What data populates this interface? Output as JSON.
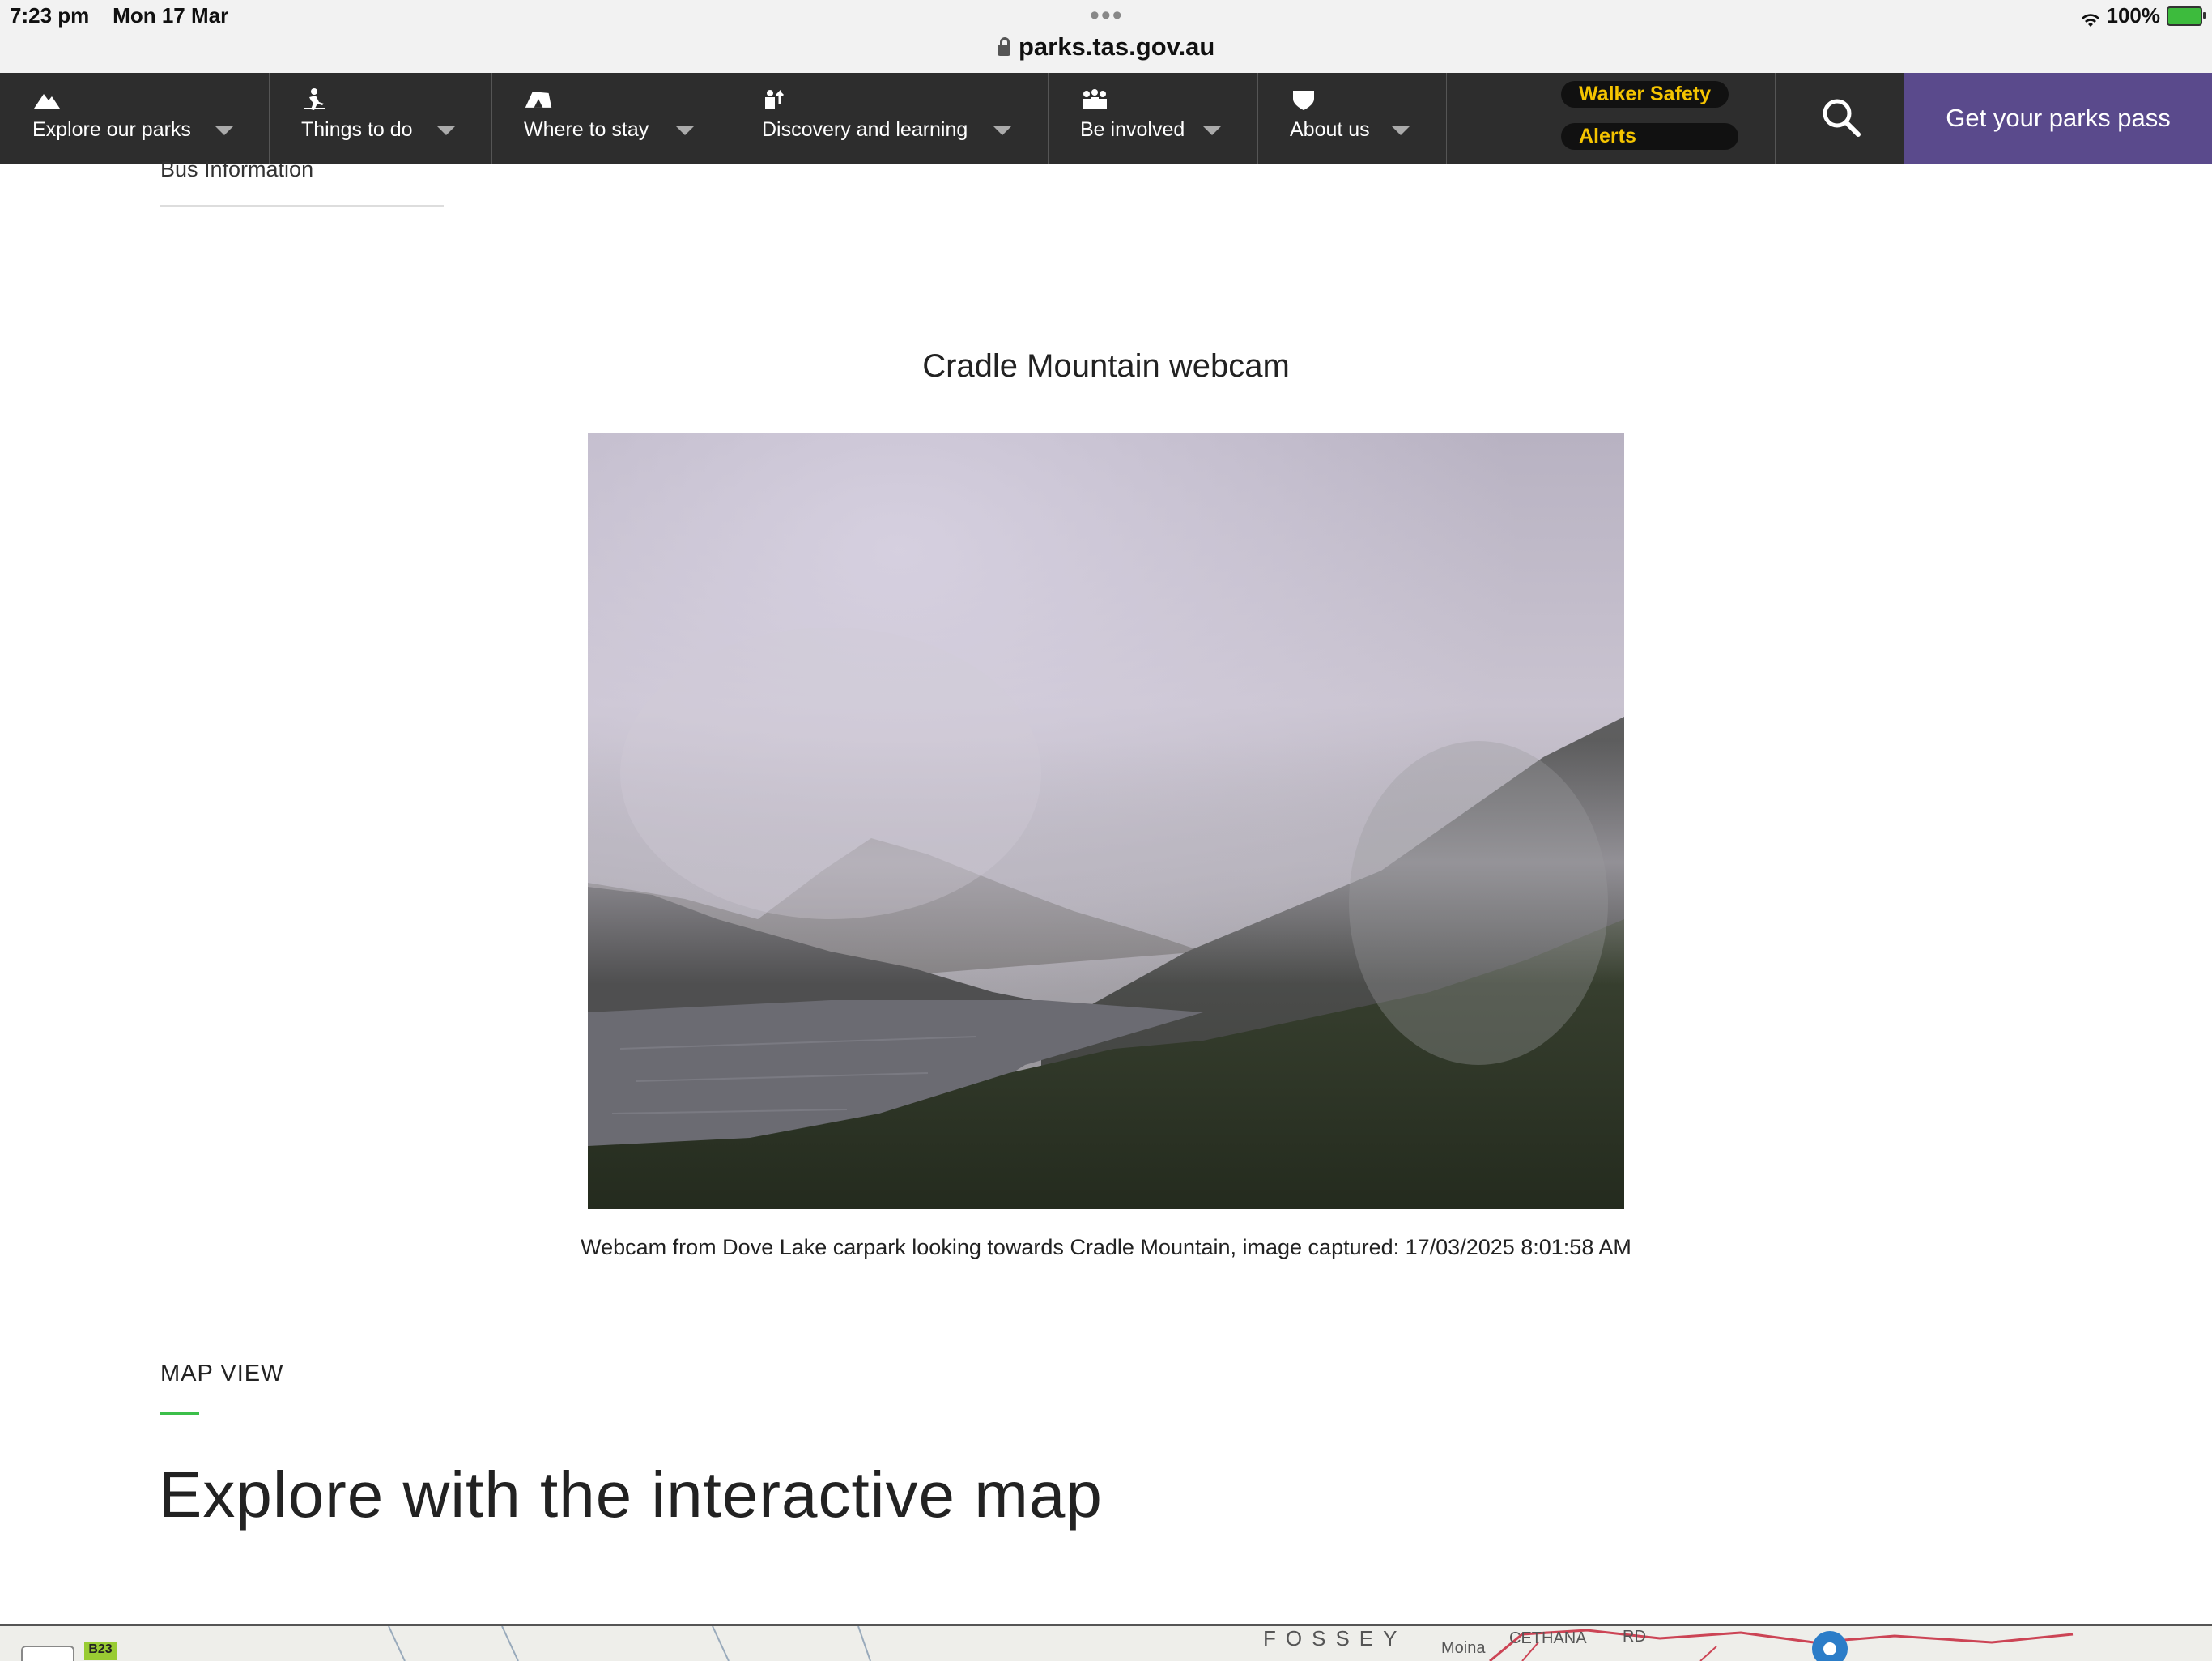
{
  "status_bar": {
    "time": "7:23 pm",
    "date": "Mon 17 Mar",
    "url": "parks.tas.gov.au",
    "battery": "100%"
  },
  "nav": {
    "items": [
      {
        "label": "Explore our parks",
        "icon": "mountain-icon"
      },
      {
        "label": "Things to do",
        "icon": "hiker-icon"
      },
      {
        "label": "Where to stay",
        "icon": "tent-icon"
      },
      {
        "label": "Discovery and learning",
        "icon": "discovery-icon"
      },
      {
        "label": "Be involved",
        "icon": "people-icon"
      },
      {
        "label": "About us",
        "icon": "shield-icon"
      }
    ],
    "walker_safety": "Walker Safety",
    "alerts": "Alerts",
    "pass_button": "Get your parks pass"
  },
  "sidebar": {
    "bus_info": "Bus Information"
  },
  "webcam": {
    "title": "Cradle Mountain webcam",
    "caption": "Webcam from Dove Lake carpark looking towards Cradle Mountain, image captured: 17/03/2025 8:01:58 AM"
  },
  "map_section": {
    "eyebrow": "MAP VIEW",
    "heading": "Explore with the interactive map"
  },
  "map": {
    "labels": [
      "B23",
      "FOSSEY",
      "Moina",
      "CETHANA",
      "RD"
    ]
  },
  "colors": {
    "nav_bg": "#2d2d2d",
    "pass_bg": "#5a4a8c",
    "alert_text": "#f5c400",
    "accent_green": "#3cbf4a"
  }
}
